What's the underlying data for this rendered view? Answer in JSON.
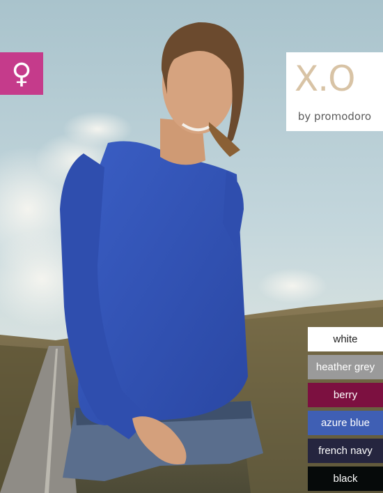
{
  "gender_badge": {
    "symbol": "♀",
    "color": "#c53b8b",
    "icon": "female-symbol-icon"
  },
  "brand": {
    "mark": "X.O",
    "byline": "by promodoro",
    "mark_color": "#d8c3a5"
  },
  "colors": [
    {
      "label": "white",
      "bg": "#ffffff",
      "fg": "#222222"
    },
    {
      "label": "heather grey",
      "bg": "#9a9a9a",
      "fg": "#ffffff"
    },
    {
      "label": "berry",
      "bg": "#7c1040",
      "fg": "#ffffff"
    },
    {
      "label": "azure blue",
      "bg": "#3f5fb4",
      "fg": "#ffffff"
    },
    {
      "label": "french navy",
      "bg": "#25253f",
      "fg": "#ffffff"
    },
    {
      "label": "black",
      "bg": "#060a0a",
      "fg": "#ffffff"
    }
  ]
}
